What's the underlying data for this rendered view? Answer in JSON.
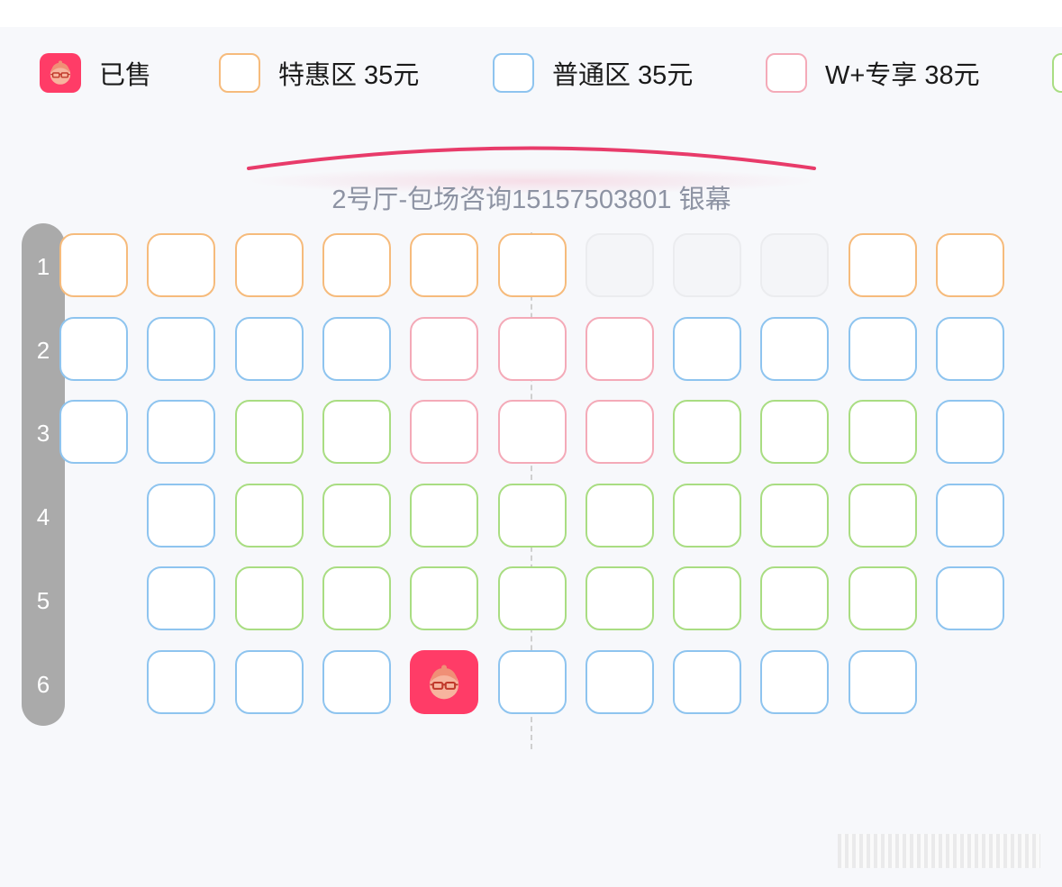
{
  "colors": {
    "sold": "#ff3c67",
    "special": "#f6bb7c",
    "normal": "#8ec4ef",
    "wplus": "#f4aab8",
    "green": "#a9dd82",
    "disabled": "#ebecef",
    "screen_curve": "#e83b6a"
  },
  "legend": [
    {
      "key": "sold",
      "label": "已售",
      "icon": "sold-face-icon"
    },
    {
      "key": "special",
      "label": "特惠区 35元"
    },
    {
      "key": "normal",
      "label": "普通区 35元"
    },
    {
      "key": "wplus",
      "label": "W+专享 38元"
    },
    {
      "key": "green",
      "label": ""
    }
  ],
  "screen": {
    "label": "2号厅-包场咨询15157503801 银幕"
  },
  "rows": [
    "1",
    "2",
    "3",
    "4",
    "5",
    "6"
  ],
  "seat_map": [
    [
      "special",
      "special",
      "special",
      "special",
      "special",
      "special",
      "disabled",
      "disabled",
      "disabled",
      "special",
      "special"
    ],
    [
      "normal",
      "normal",
      "normal",
      "normal",
      "wplus",
      "wplus",
      "wplus",
      "normal",
      "normal",
      "normal",
      "normal"
    ],
    [
      "normal",
      "normal",
      "green",
      "green",
      "wplus",
      "wplus",
      "wplus",
      "green",
      "green",
      "green",
      "normal"
    ],
    [
      null,
      "normal",
      "green",
      "green",
      "green",
      "green",
      "green",
      "green",
      "green",
      "green",
      "normal"
    ],
    [
      null,
      "normal",
      "green",
      "green",
      "green",
      "green",
      "green",
      "green",
      "green",
      "green",
      "normal"
    ],
    [
      null,
      "normal",
      "normal",
      "normal",
      "sold",
      "normal",
      "normal",
      "normal",
      "normal",
      "normal",
      null
    ]
  ]
}
